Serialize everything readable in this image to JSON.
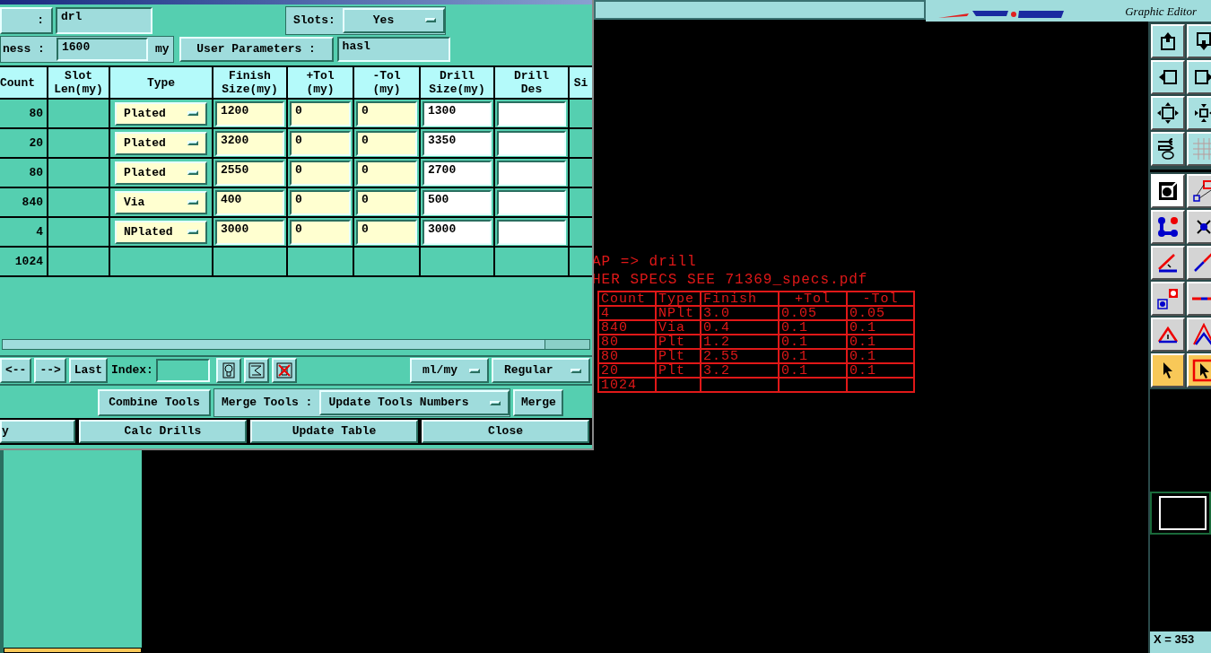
{
  "dialog": {
    "row1": {
      "label": ":",
      "value": "drl",
      "slots_label": "Slots:",
      "slots_value": "Yes"
    },
    "row2": {
      "label": "ness :",
      "value": "1600",
      "unit": "my",
      "user_params_button": "User Parameters :",
      "user_params_value": "hasl"
    },
    "columns": [
      "Count",
      "Slot\nLen(my)",
      "Type",
      "Finish\nSize(my)",
      "+Tol\n(my)",
      "-Tol\n(my)",
      "Drill\nSize(my)",
      "Drill\nDes",
      "Si"
    ],
    "rows": [
      {
        "count": "80",
        "type": "Plated",
        "finish": "1200",
        "plus_tol": "0",
        "minus_tol": "0",
        "drill_size": "1300"
      },
      {
        "count": "20",
        "type": "Plated",
        "finish": "3200",
        "plus_tol": "0",
        "minus_tol": "0",
        "drill_size": "3350"
      },
      {
        "count": "80",
        "type": "Plated",
        "finish": "2550",
        "plus_tol": "0",
        "minus_tol": "0",
        "drill_size": "2700"
      },
      {
        "count": "840",
        "type": "Via",
        "finish": "400",
        "plus_tol": "0",
        "minus_tol": "0",
        "drill_size": "500"
      },
      {
        "count": "4",
        "type": "NPlated",
        "finish": "3000",
        "plus_tol": "0",
        "minus_tol": "0",
        "drill_size": "3000"
      }
    ],
    "total": "1024",
    "nav_buttons": [
      "<--",
      "-->",
      "Last"
    ],
    "index_label": "Index:",
    "units_dropdown": "ml/my",
    "mode_dropdown": "Regular",
    "combine_button": "Combine Tools",
    "merge_label": "Merge Tools :",
    "merge_dropdown": "Update Tools Numbers",
    "merge_button": "Merge",
    "bottom_buttons": [
      "y",
      "Calc Drills",
      "Update Table",
      "Close"
    ]
  },
  "editor": {
    "subtitle": "Graphic Editor",
    "canvas_lines": [
      "AP => drill",
      "HER SPECS SEE 71369_specs.pdf"
    ],
    "spec_table": {
      "columns": [
        "Count",
        "Type",
        "Finish",
        "+Tol",
        "-Tol"
      ],
      "rows": [
        [
          "4",
          "NPlt",
          "3.0",
          "0.05",
          "0.05"
        ],
        [
          "840",
          "Via",
          "0.4",
          "0.1",
          "0.1"
        ],
        [
          "80",
          "Plt",
          "1.2",
          "0.1",
          "0.1"
        ],
        [
          "80",
          "Plt",
          "2.55",
          "0.1",
          "0.1"
        ],
        [
          "20",
          "Plt",
          "3.2",
          "0.1",
          "0.1"
        ],
        [
          "1024"
        ]
      ]
    },
    "view_tools": [
      {
        "kind": "move-up",
        "selected": false
      },
      {
        "kind": "move-down",
        "selected": false
      },
      {
        "kind": "move-left",
        "selected": false
      },
      {
        "kind": "move-right",
        "selected": false
      },
      {
        "kind": "fit",
        "selected": false
      },
      {
        "kind": "zoom",
        "selected": false
      },
      {
        "kind": "tools",
        "selected": false
      },
      {
        "kind": "grid",
        "selected": false
      }
    ],
    "edit_tools": [
      {
        "kind": "fill",
        "selected": false
      },
      {
        "kind": "snap",
        "selected": false
      },
      {
        "kind": "nodes",
        "selected": false
      },
      {
        "kind": "cross",
        "selected": false
      },
      {
        "kind": "angle",
        "selected": false
      },
      {
        "kind": "line",
        "selected": false
      },
      {
        "kind": "pads",
        "selected": false
      },
      {
        "kind": "hline",
        "selected": false
      },
      {
        "kind": "triangle",
        "selected": false
      },
      {
        "kind": "triangles",
        "selected": false
      },
      {
        "kind": "pointer",
        "selected": true
      },
      {
        "kind": "pointer-box",
        "selected": true
      }
    ],
    "coords": "X = 353"
  }
}
